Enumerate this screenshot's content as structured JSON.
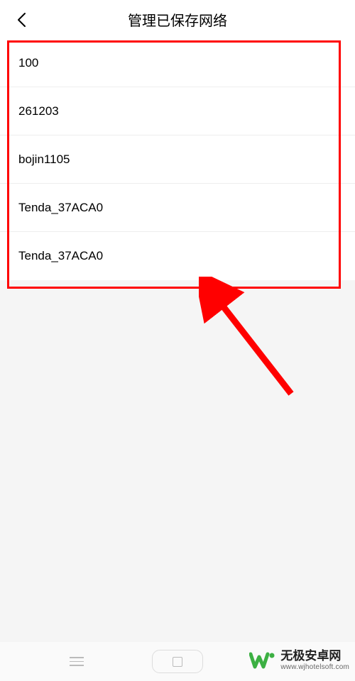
{
  "header": {
    "title": "管理已保存网络"
  },
  "networks": [
    {
      "name": "100"
    },
    {
      "name": "261203"
    },
    {
      "name": "bojin1105"
    },
    {
      "name": "Tenda_37ACA0"
    },
    {
      "name": "Tenda_37ACA0"
    }
  ],
  "watermark": {
    "name": "无极安卓网",
    "url": "www.wjhotelsoft.com"
  },
  "annotation": {
    "highlight_color": "#ff0000",
    "arrow_color": "#ff0000"
  }
}
